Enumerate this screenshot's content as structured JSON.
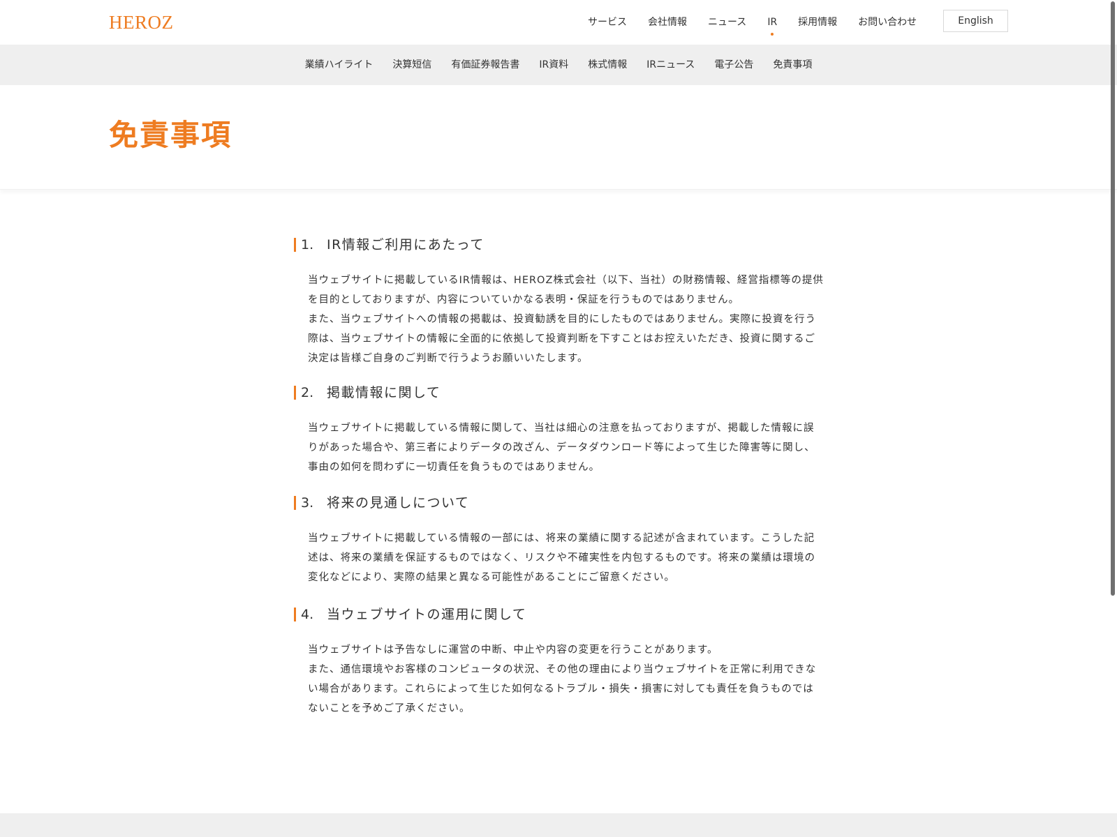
{
  "header": {
    "logo": "HEROZ",
    "nav": [
      {
        "label": "サービス"
      },
      {
        "label": "会社情報"
      },
      {
        "label": "ニュース"
      },
      {
        "label": "IR"
      },
      {
        "label": "採用情報"
      },
      {
        "label": "お問い合わせ"
      }
    ],
    "active_nav": "IR",
    "lang_button": "English"
  },
  "subnav": [
    {
      "label": "業績ハイライト"
    },
    {
      "label": "決算短信"
    },
    {
      "label": "有価証券報告書"
    },
    {
      "label": "IR資料"
    },
    {
      "label": "株式情報"
    },
    {
      "label": "IRニュース"
    },
    {
      "label": "電子公告"
    },
    {
      "label": "免責事項"
    }
  ],
  "page": {
    "title": "免責事項"
  },
  "sections": [
    {
      "number": "1.",
      "heading": "IR情報ご利用にあたって",
      "paragraphs": [
        "当ウェブサイトに掲載しているIR情報は、HEROZ株式会社（以下、当社）の財務情報、経営指標等の提供を目的としておりますが、内容についていかなる表明・保証を行うものではありません。",
        "また、当ウェブサイトへの情報の掲載は、投資勧誘を目的にしたものではありません。実際に投資を行う際は、当ウェブサイトの情報に全面的に依拠して投資判断を下すことはお控えいただき、投資に関するご決定は皆様ご自身のご判断で行うようお願いいたします。"
      ]
    },
    {
      "number": "2.",
      "heading": "掲載情報に関して",
      "paragraphs": [
        "当ウェブサイトに掲載している情報に関して、当社は細心の注意を払っておりますが、掲載した情報に誤りがあった場合や、第三者によりデータの改ざん、データダウンロード等によって生じた障害等に関し、事由の如何を問わずに一切責任を負うものではありません。"
      ]
    },
    {
      "number": "3.",
      "heading": "将来の見通しについて",
      "paragraphs": [
        "当ウェブサイトに掲載している情報の一部には、将来の業績に関する記述が含まれています。こうした記述は、将来の業績を保証するものではなく、リスクや不確実性を内包するものです。将来の業績は環境の変化などにより、実際の結果と異なる可能性があることにご留意ください。"
      ]
    },
    {
      "number": "4.",
      "heading": "当ウェブサイトの運用に関して",
      "paragraphs": [
        "当ウェブサイトは予告なしに運営の中断、中止や内容の変更を行うことがあります。",
        "また、通信環境やお客様のコンピュータの状況、その他の理由により当ウェブサイトを正常に利用できない場合があります。これらによって生じた如何なるトラブル・損失・損害に対しても責任を負うものではないことを予めご了承ください。"
      ]
    }
  ],
  "colors": {
    "accent": "#ee7c21",
    "text": "#333333",
    "subnav_bg": "#efefef"
  }
}
